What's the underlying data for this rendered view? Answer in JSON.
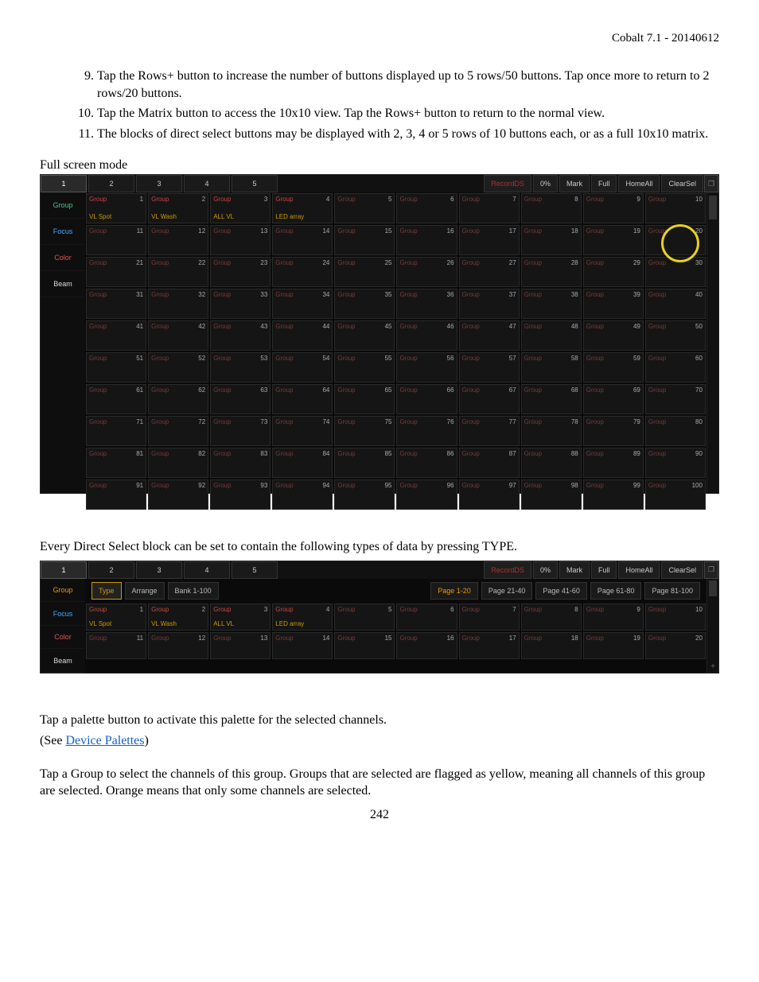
{
  "header": {
    "title": "Cobalt 7.1 - 20140612"
  },
  "instructions": {
    "start": 9,
    "items": [
      "Tap the Rows+ button to increase the number of buttons displayed up to 5 rows/50 buttons. Tap once more to return to 2 rows/20 buttons.",
      "Tap the Matrix button to access the 10x10 view. Tap the Rows+ button to return to the normal view.",
      "The blocks of direct select buttons may be displayed with 2, 3, 4 or 5 rows of 10 buttons each, or as a full 10x10 matrix."
    ]
  },
  "section1_label": "Full screen mode",
  "topbar": {
    "tabs": [
      "1",
      "2",
      "3",
      "4",
      "5"
    ],
    "buttons": {
      "record": "RecordDS",
      "zero": "0%",
      "mark": "Mark",
      "full": "Full",
      "homeall": "HomeAll",
      "clearsel": "ClearSel"
    }
  },
  "sidebar": {
    "group": "Group",
    "focus": "Focus",
    "color": "Color",
    "beam": "Beam"
  },
  "named_slots": {
    "1": "VL Spot",
    "2": "VL Wash",
    "3": "ALL VL",
    "4": "LED array"
  },
  "cell_label": "Group",
  "grid": {
    "rows": 10,
    "cols": 10
  },
  "intro2": "Every Direct Select block can be set to contain the following types of data by pressing TYPE.",
  "toolbar2": {
    "left": {
      "type": "Type",
      "arrange": "Arrange",
      "bank": "Bank 1-100"
    },
    "pages": [
      "Page 1-20",
      "Page 21-40",
      "Page 41-60",
      "Page 61-80",
      "Page 81-100"
    ]
  },
  "p_palette": "Tap a palette button to activate this palette for the selected channels.",
  "p_see": "(See ",
  "p_see_link": "Device Palettes",
  "p_see_end": ")",
  "p_group": "Tap a Group to select the channels of this group. Groups that are selected are flagged as yellow, meaning all channels of this group are selected. Orange means that only some channels are selected.",
  "pagenum": "242"
}
